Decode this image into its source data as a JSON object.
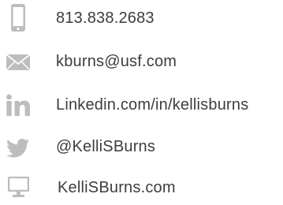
{
  "contacts": {
    "phone": {
      "icon": "phone-icon",
      "text": "813.838.2683"
    },
    "email": {
      "icon": "envelope-icon",
      "text": "kburns@usf.com"
    },
    "linkedin": {
      "icon": "linkedin-icon",
      "text": "Linkedin.com/in/kellisburns"
    },
    "twitter": {
      "icon": "twitter-bird-icon",
      "text": "@KelliSBurns"
    },
    "website": {
      "icon": "monitor-icon",
      "text": "KelliSBurns.com"
    }
  },
  "colors": {
    "icon": "#bdbdbd",
    "text": "#3d3d3d",
    "background": "#ffffff"
  }
}
